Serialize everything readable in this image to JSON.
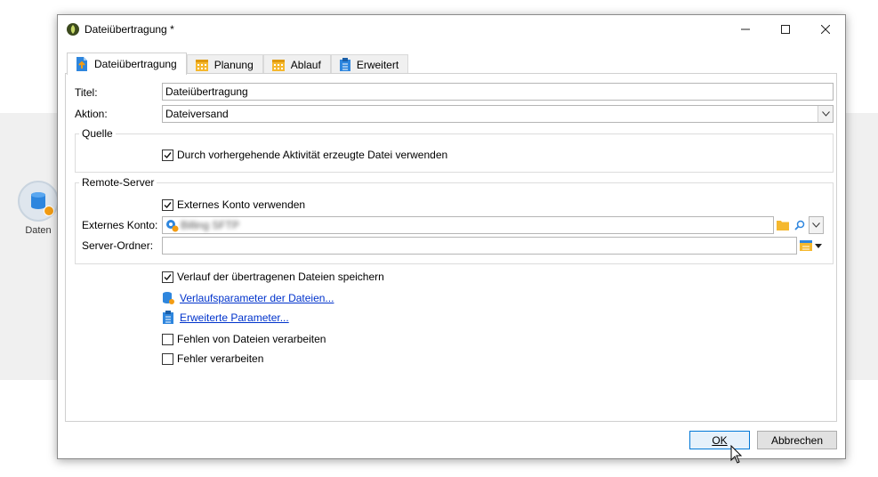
{
  "background": {
    "node": {
      "label": "Daten",
      "icon": "database-icon"
    }
  },
  "dialog": {
    "title": "Dateiübertragung *",
    "tabs": [
      {
        "label": "Dateiübertragung",
        "icon": "file-upload-icon"
      },
      {
        "label": "Planung",
        "icon": "calendar-icon"
      },
      {
        "label": "Ablauf",
        "icon": "calendar-icon"
      },
      {
        "label": "Erweitert",
        "icon": "clipboard-icon"
      }
    ],
    "form": {
      "title_label": "Titel:",
      "title_value": "Dateiübertragung",
      "action_label": "Aktion:",
      "action_value": "Dateiversand",
      "source_group": "Quelle",
      "source_checkbox": "Durch vorhergehende Aktivität erzeugte Datei verwenden",
      "remote_group": "Remote-Server",
      "external_checkbox": "Externes Konto verwenden",
      "external_account_label": "Externes Konto:",
      "external_account_value": "Billing SFTP",
      "server_folder_label": "Server-Ordner:",
      "server_folder_value": "",
      "history_checkbox": "Verlauf der übertragenen Dateien speichern",
      "history_link": "Verlaufsparameter der Dateien...",
      "advanced_link": "Erweiterte Parameter...",
      "missing_files_checkbox": "Fehlen von Dateien verarbeiten",
      "errors_checkbox": "Fehler verarbeiten"
    },
    "buttons": {
      "ok": "OK",
      "cancel": "Abbrechen"
    }
  },
  "colors": {
    "accent": "#0078d7",
    "link": "#0033cc",
    "node_badge": "#f39c12"
  }
}
